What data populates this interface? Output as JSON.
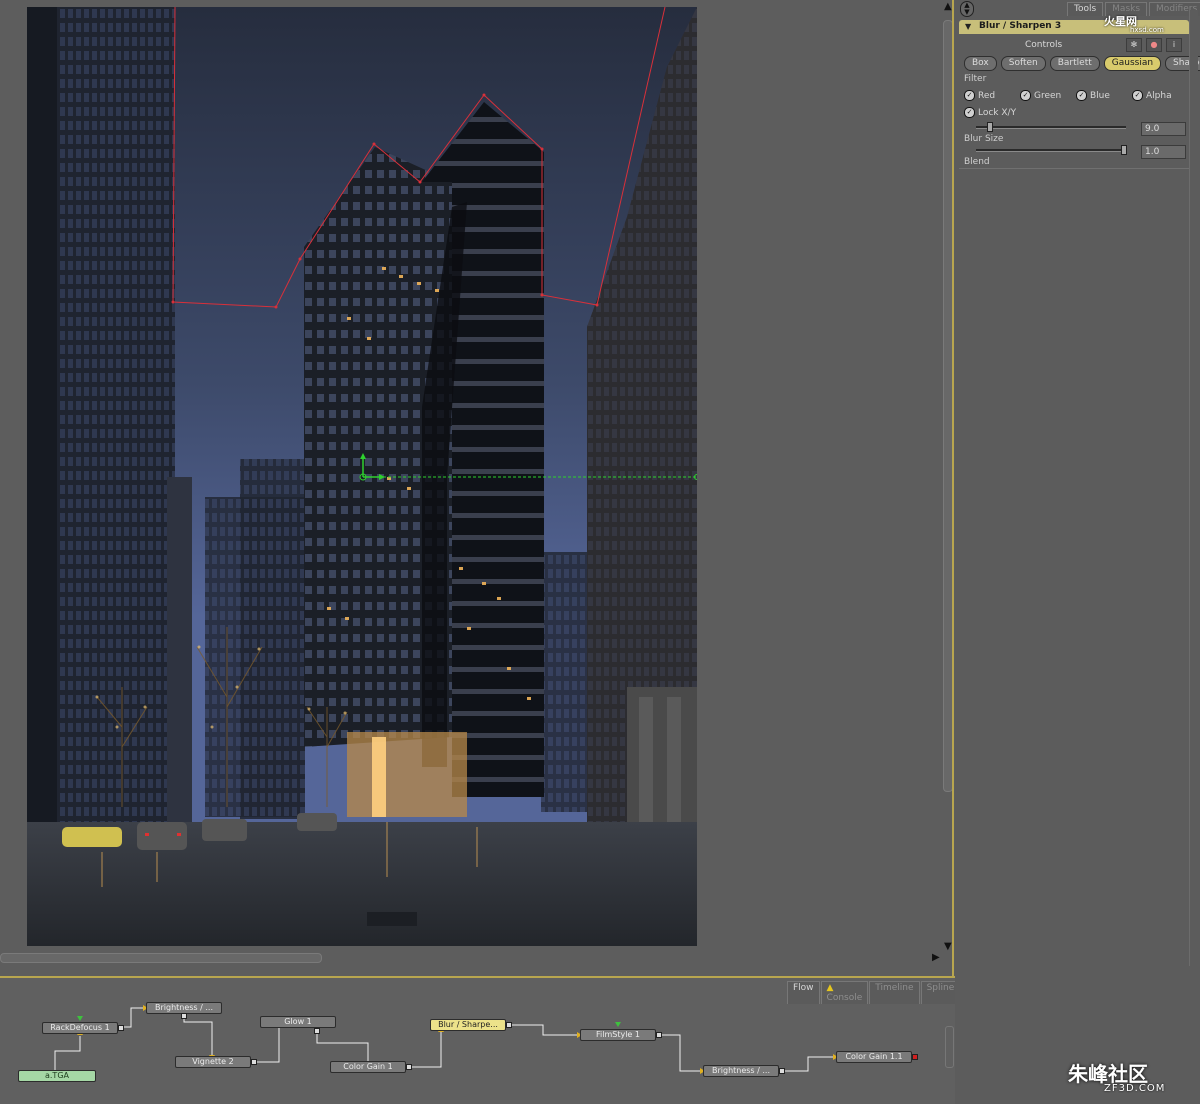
{
  "panel": {
    "tabs": [
      "Tools",
      "Masks",
      "Modifiers"
    ],
    "tool_title": "Blur / Sharpen 3",
    "controls_label": "Controls",
    "filter_buttons": [
      "Box",
      "Soften",
      "Bartlett",
      "Gaussian",
      "Sharpen"
    ],
    "active_filter": "Gaussian",
    "filter_label": "Filter",
    "channels": [
      {
        "label": "Red",
        "checked": true
      },
      {
        "label": "Green",
        "checked": true
      },
      {
        "label": "Blue",
        "checked": true
      },
      {
        "label": "Alpha",
        "checked": true
      }
    ],
    "lock_label": "Lock X/Y",
    "blur_size": {
      "label": "Blur Size",
      "value": "9.0"
    },
    "blend": {
      "label": "Blend",
      "value": "1.0"
    }
  },
  "flow": {
    "tabs": [
      "Flow",
      "Console",
      "Timeline",
      "Spline"
    ],
    "nodes": {
      "rackdefocus": "RackDefocus 1",
      "atga": "a.TGA",
      "brightness1": "Brightness / ...",
      "vignette": "Vignette 2",
      "glow": "Glow 1",
      "colorgain1": "Color Gain 1",
      "blursharpen": "Blur / Sharpe...",
      "filmstyle": "FilmStyle 1",
      "brightness2": "Brightness / ...",
      "colorgain11": "Color Gain 1.1"
    }
  },
  "watermarks": {
    "top": "火星网",
    "top_sub": "hxsd.com",
    "bottom": "朱峰社区",
    "bottom_sub": "ZF3D.COM"
  },
  "colors": {
    "accent": "#c8bf7a",
    "active_button": "#d9cb6c",
    "mask_polygon": "#d8303a",
    "guide": "#2ed12e",
    "loader_node": "#a5d7a5",
    "selected_node": "#ece28a"
  }
}
